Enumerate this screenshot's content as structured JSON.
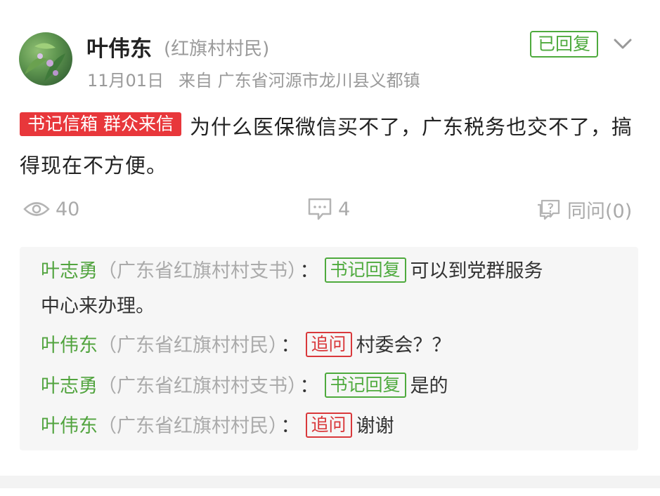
{
  "post": {
    "author_name": "叶伟东",
    "author_role": "(红旗村村民)",
    "date": "11月01日",
    "from": "来自 广东省河源市龙川县义都镇",
    "status_badge": "已回复",
    "category_tag": "书记信箱 群众来信",
    "content_line1": "为什么医保微信买不了，广东税务也交不了，搞",
    "content_line2": "得现在不方便。"
  },
  "stats": {
    "views": "40",
    "comments": "4",
    "ask_also": "同问(0)"
  },
  "replies": [
    {
      "author": "叶志勇",
      "role": "（广东省红旗村村支书）",
      "colon": "：",
      "tag": "书记回复",
      "text_line1": "可以到党群服务",
      "text_line2": "中心来办理。"
    },
    {
      "author": "叶伟东",
      "role": "（广东省红旗村村民）",
      "colon": "：",
      "tag": "追问",
      "text": "村委会？？"
    },
    {
      "author": "叶志勇",
      "role": "（广东省红旗村村支书）",
      "colon": "：",
      "tag": "书记回复",
      "text": "是的"
    },
    {
      "author": "叶伟东",
      "role": "（广东省红旗村村民）",
      "colon": "：",
      "tag": "追问",
      "text": "谢谢"
    }
  ],
  "icons": {
    "views": "eye-icon",
    "comments": "comment-icon",
    "ask_also": "ask-also-icon",
    "expand": "chevron-down-icon"
  },
  "colors": {
    "green": "#4eaa3d",
    "red": "#e8373b",
    "author_green": "#52a43f"
  }
}
